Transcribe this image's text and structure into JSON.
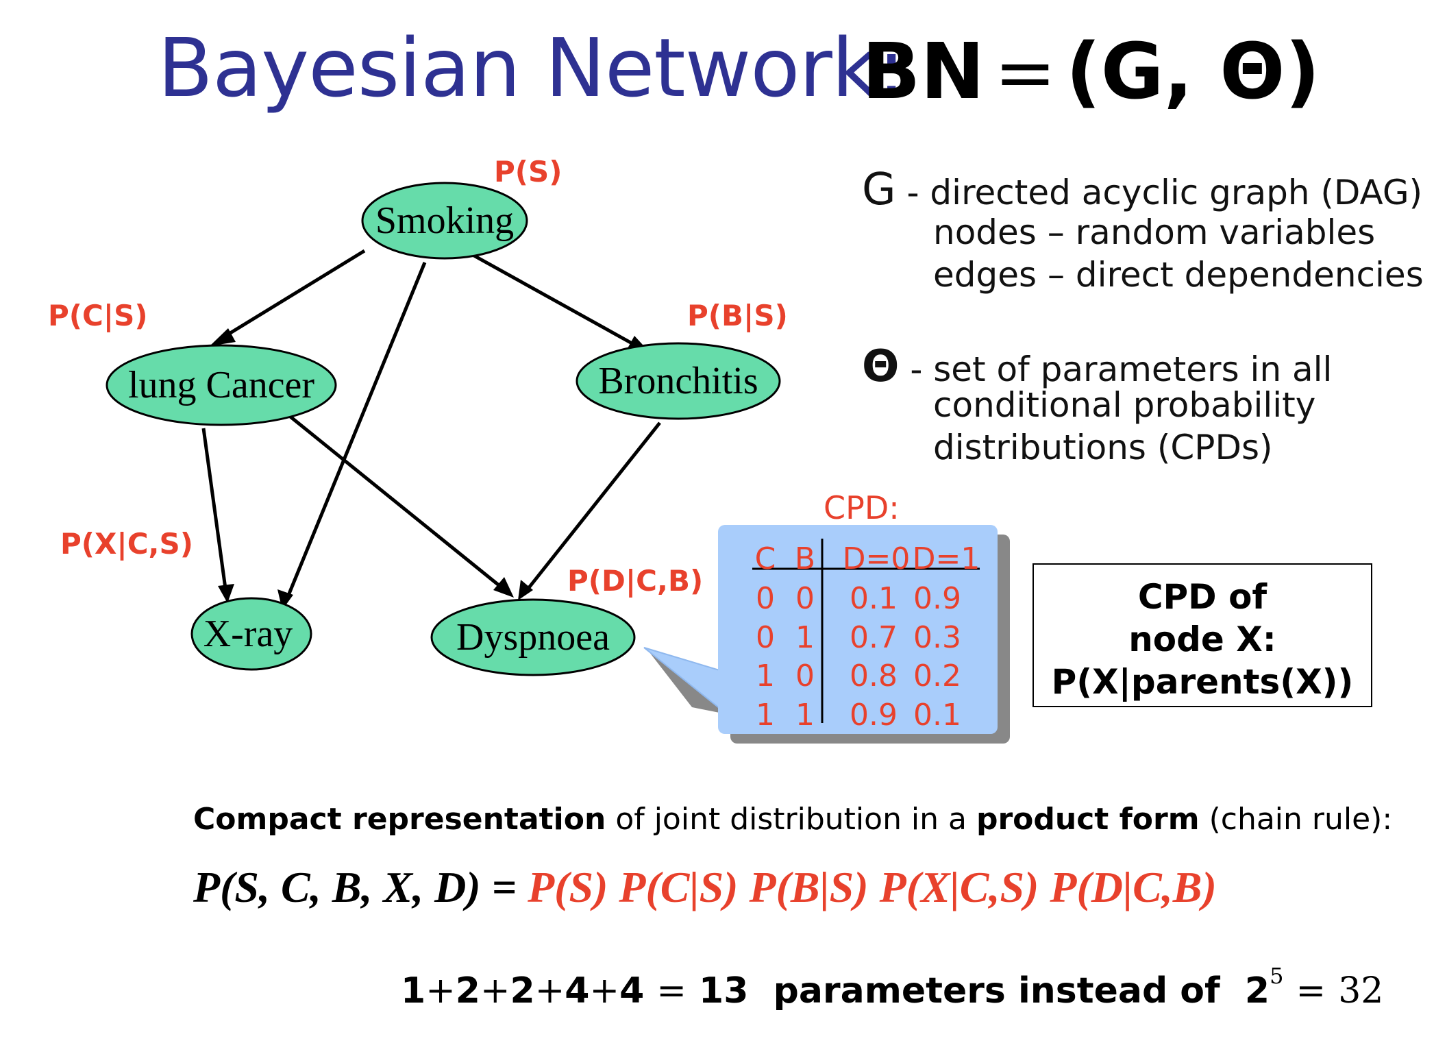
{
  "title": {
    "main": "Bayesian Network:",
    "lhs": "BN",
    "eq": "=",
    "rhs": "(G, Θ)"
  },
  "graph": {
    "nodes": {
      "smoking": "Smoking",
      "cancer": "lung Cancer",
      "bronchitis": "Bronchitis",
      "xray": "X-ray",
      "dyspnoea": "Dyspnoea"
    },
    "node_fill": "#66dcaa",
    "edge_color": "#000000",
    "probabilities": {
      "s": "P(S)",
      "c_s": "P(C|S)",
      "b_s": "P(B|S)",
      "x_cs": "P(X|C,S)",
      "d_cb": "P(D|C,B)"
    }
  },
  "description": {
    "g_symbol": "G",
    "g_line1": "- directed acyclic graph (DAG)",
    "g_line2": "nodes – random variables",
    "g_line3": "edges – direct dependencies",
    "theta_symbol": "Θ",
    "theta_line1": "- set of parameters in all",
    "theta_line2": "conditional probability",
    "theta_line3": "distributions (CPDs)"
  },
  "cpd": {
    "caption": "CPD:",
    "headers": [
      "C",
      "B",
      "D=0",
      "D=1"
    ],
    "rows": [
      [
        "0",
        "0",
        "0.1",
        "0.9"
      ],
      [
        "0",
        "1",
        "0.7",
        "0.3"
      ],
      [
        "1",
        "0",
        "0.8",
        "0.2"
      ],
      [
        "1",
        "1",
        "0.9",
        "0.1"
      ]
    ],
    "box_fill": "#a9cdfb",
    "text_color": "#e8412c"
  },
  "cpd_box": {
    "line1": "CPD of",
    "line2": "node X:",
    "line3": "P(X|parents(X))"
  },
  "compact": {
    "bold1": "Compact representation",
    "mid": " of joint distribution in a ",
    "bold2": "product form",
    "end": " (chain rule):"
  },
  "joint": {
    "lhs": "P(S, C, B, X, D)",
    "eq": " = ",
    "rhs": "P(S) P(C|S) P(B|S) P(X|C,S) P(D|C,B)"
  },
  "count": {
    "n1": "1",
    "n2": "2",
    "n3": "2",
    "n4": "4",
    "n5": "4",
    "plus": "+",
    "eq": "=",
    "total": "13",
    "text": "parameters  instead of",
    "base": "2",
    "exp": "5",
    "eq2": "=",
    "full": "32"
  }
}
